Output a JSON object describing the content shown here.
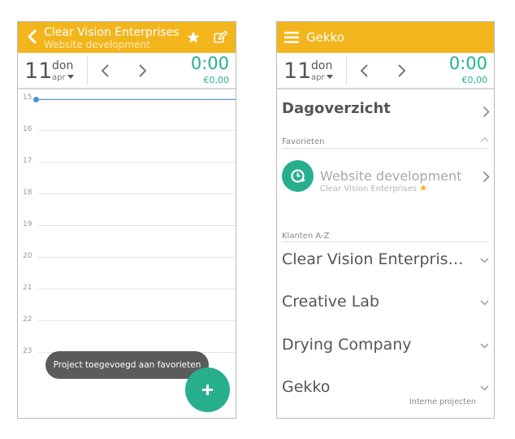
{
  "colors": {
    "topbar": "#f2b51c",
    "accent_green": "#27af8d",
    "now_line": "#4a90e2",
    "toast": "#5b5b5b"
  },
  "left_screen": {
    "header": {
      "title": "Clear Vision Enterprises",
      "subtitle": "Website development",
      "icons": [
        "back-arrow-icon",
        "star-icon",
        "edit-icon"
      ]
    },
    "datebar": {
      "day": "11",
      "weekday": "don",
      "month": "apr",
      "time": "0:00",
      "amount": "€0,00"
    },
    "hours": [
      "15",
      "16",
      "17",
      "18",
      "19",
      "20",
      "21",
      "22",
      "23"
    ],
    "toast": "Project toegevoegd aan favorieten",
    "fab_icon": "plus-icon"
  },
  "right_screen": {
    "header": {
      "title": "Gekko",
      "icons": [
        "hamburger-menu-icon"
      ]
    },
    "datebar": {
      "day": "11",
      "weekday": "don",
      "month": "apr",
      "time": "0:00",
      "amount": "€0,00"
    },
    "overview": "Dagoverzicht",
    "favorites_header": "Favorieten",
    "favorite": {
      "title": "Website development",
      "client": "Clear Vision Enterprises",
      "icon": "clock-play-icon"
    },
    "clients_header": "Klanten A-Z",
    "clients": [
      "Clear Vision Enterpris…",
      "Creative Lab",
      "Drying Company",
      "Gekko"
    ],
    "gekko_note": "Interne projecten"
  }
}
